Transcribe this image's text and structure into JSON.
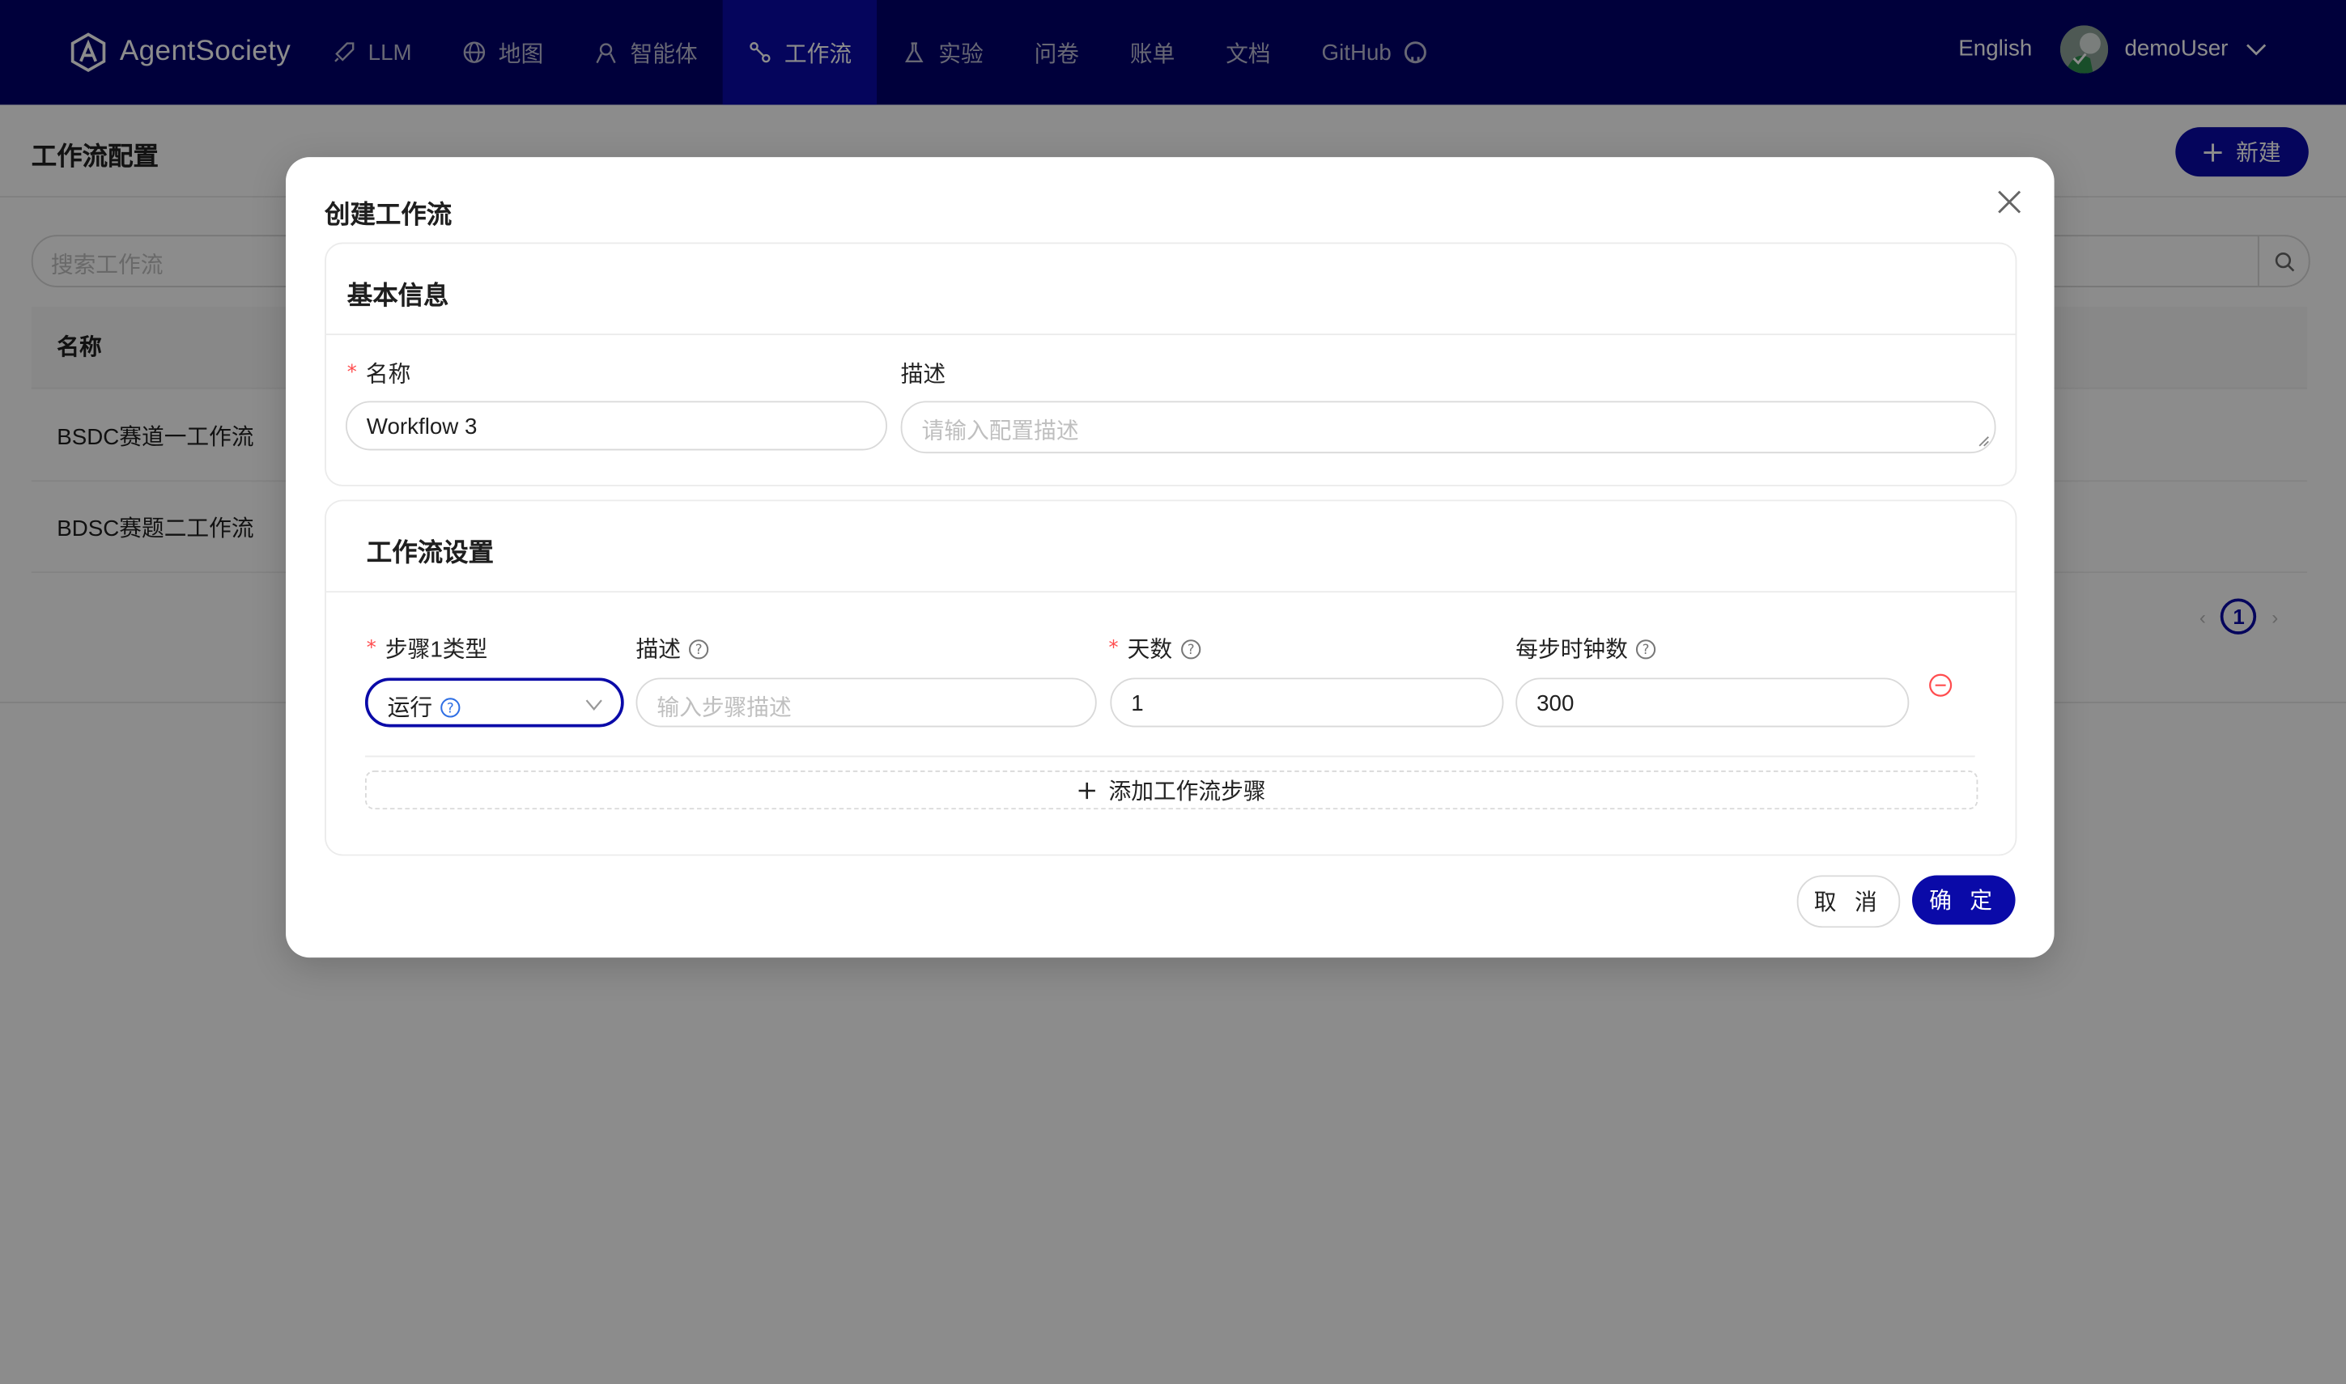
{
  "app": {
    "brand": "AgentSociety",
    "nav": [
      {
        "label": "LLM",
        "icon": "rocket-icon",
        "active": false
      },
      {
        "label": "地图",
        "icon": "globe-icon",
        "active": false
      },
      {
        "label": "智能体",
        "icon": "agent-icon",
        "active": false
      },
      {
        "label": "工作流",
        "icon": "workflow-icon",
        "active": true
      },
      {
        "label": "实验",
        "icon": "flask-icon",
        "active": false
      },
      {
        "label": "问卷",
        "icon": "",
        "active": false
      },
      {
        "label": "账单",
        "icon": "",
        "active": false
      },
      {
        "label": "文档",
        "icon": "",
        "active": false
      },
      {
        "label": "GitHub",
        "icon": "github-icon",
        "active": false
      }
    ],
    "language": "English",
    "username": "demoUser"
  },
  "page": {
    "title": "工作流配置",
    "new_button": "新建",
    "search_placeholder": "搜索工作流",
    "table": {
      "columns": [
        "名称"
      ],
      "rows": [
        "BSDC赛道一工作流",
        "BDSC赛题二工作流"
      ]
    },
    "pagination": {
      "current": "1"
    }
  },
  "modal": {
    "title": "创建工作流",
    "basic": {
      "title": "基本信息",
      "name_label": "名称",
      "name_value": "Workflow 3",
      "desc_label": "描述",
      "desc_placeholder": "请输入配置描述"
    },
    "workflow": {
      "title": "工作流设置",
      "step_type_label": "步骤1类型",
      "step_type_value": "运行",
      "step_desc_label": "描述",
      "step_desc_placeholder": "输入步骤描述",
      "days_label": "天数",
      "days_value": "1",
      "ticks_label": "每步时钟数",
      "ticks_value": "300",
      "add_step": "添加工作流步骤"
    },
    "cancel": "取 消",
    "ok": "确 定"
  },
  "colors": {
    "nav_bg": "#01006c",
    "nav_active": "#0a0aa8",
    "primary": "#0a0aa8",
    "required": "#ff4d4f"
  }
}
